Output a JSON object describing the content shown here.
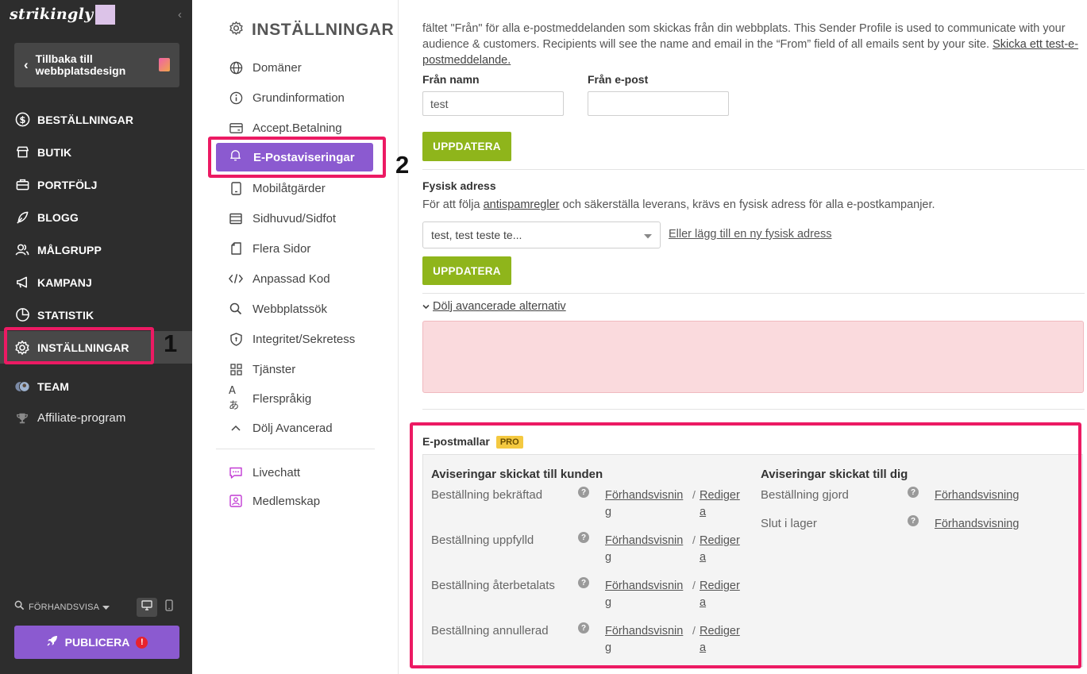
{
  "sidebar": {
    "logo": "strikingly",
    "back_label": "Tillbaka till webbplatsdesign",
    "items": [
      {
        "label": "BESTÄLLNINGAR",
        "icon": "dollar-icon"
      },
      {
        "label": "BUTIK",
        "icon": "store-icon"
      },
      {
        "label": "PORTFÖLJ",
        "icon": "briefcase-icon"
      },
      {
        "label": "BLOGG",
        "icon": "feather-icon"
      },
      {
        "label": "MÅLGRUPP",
        "icon": "users-icon"
      },
      {
        "label": "KAMPANJ",
        "icon": "megaphone-icon"
      },
      {
        "label": "STATISTIK",
        "icon": "pie-chart-icon"
      },
      {
        "label": "INSTÄLLNINGAR",
        "icon": "gear-icon",
        "active": true
      },
      {
        "label": "TEAM",
        "icon": "team-avatars-icon"
      },
      {
        "label": "Affiliate-program",
        "icon": "trophy-icon"
      }
    ],
    "preview_label": "FÖRHANDSVISA",
    "publish_label": "PUBLICERA",
    "publish_alert": "!"
  },
  "callouts": {
    "one": "1",
    "two": "2"
  },
  "settings_menu": {
    "title": "INSTÄLLNINGAR",
    "items": [
      {
        "label": "Domäner",
        "icon": "globe-icon"
      },
      {
        "label": "Grundinformation",
        "icon": "info-icon"
      },
      {
        "label": "Accept.Betalning",
        "icon": "payment-card-icon"
      },
      {
        "label": "E-Postaviseringar",
        "icon": "bell-icon",
        "active": true
      },
      {
        "label": "Mobilåtgärder",
        "icon": "mobile-icon"
      },
      {
        "label": "Sidhuvud/Sidfot",
        "icon": "header-footer-icon"
      },
      {
        "label": "Flera Sidor",
        "icon": "pages-icon"
      },
      {
        "label": "Anpassad Kod",
        "icon": "code-icon"
      },
      {
        "label": "Webbplatssök",
        "icon": "search-icon"
      },
      {
        "label": "Integritet/Sekretess",
        "icon": "shield-icon"
      },
      {
        "label": "Tjänster",
        "icon": "grid-icon"
      },
      {
        "label": "Flerspråkig",
        "icon": "translate-icon"
      },
      {
        "label": "Dölj Avancerad",
        "icon": "chevron-up-icon"
      }
    ],
    "extra_items": [
      {
        "label": "Livechatt",
        "icon": "chat-icon"
      },
      {
        "label": "Medlemskap",
        "icon": "member-icon"
      }
    ]
  },
  "main": {
    "intro_line1": "fältet \"Från\" för alla e-postmeddelanden som skickas från din webbplats. This Sender Profile is used to communicate with your",
    "intro_line2": "audience & customers. Recipients will see the name and email in the “From” field of all emails sent by your site.",
    "intro_link_a": "Skicka ett test-e-",
    "intro_link_b": "postmeddelande.",
    "from_name_label": "Från namn",
    "from_name_value": "test",
    "from_email_label": "Från e-post",
    "from_email_value": "",
    "update_label": "UPPDATERA",
    "address_title": "Fysisk adress",
    "address_help_pre": "För att följa",
    "address_help_link": "antispamregler",
    "address_help_post": "och säkerställa leverans, krävs en fysisk adress för alla e-postkampanjer.",
    "address_selected": "test, test teste te...",
    "address_add_link": "Eller lägg till en ny fysisk adress",
    "update2_label": "UPPDATERA",
    "advanced_toggle": "Dölj avancerade alternativ",
    "templates_title": "E-postmallar",
    "templates_badge": "PRO",
    "customer_head": "Aviseringar skickat till kunden",
    "you_head": "Aviseringar skickat till dig",
    "customer_rows": [
      {
        "label": "Beställning bekräftad"
      },
      {
        "label": "Beställning uppfylld"
      },
      {
        "label": "Beställning återbetalats"
      },
      {
        "label": "Beställning annullerad"
      }
    ],
    "you_rows": [
      {
        "label": "Beställning gjord"
      },
      {
        "label": "Slut i lager"
      }
    ],
    "preview_a": "Förhandsvisnin",
    "preview_b": "g",
    "edit_a": "Rediger",
    "edit_b": "a",
    "preview_full": "Förhandsvisning",
    "slash": "/",
    "help_q": "?"
  },
  "colors": {
    "sidebar_bg": "#2d2d2d",
    "accent_purple": "#8b5ad0",
    "update_green": "#8fb51b",
    "highlight_pink": "#ec1a63",
    "error_bg": "#fadadd",
    "pro_yellow": "#f4c940"
  }
}
